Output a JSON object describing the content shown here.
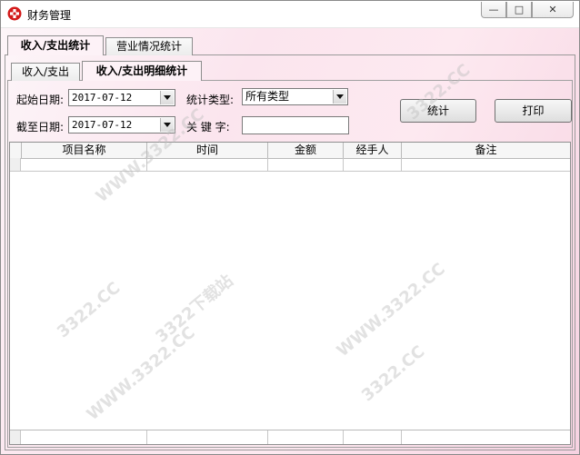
{
  "window": {
    "title": "财务管理",
    "minimize_symbol": "—",
    "maximize_symbol": "□",
    "close_symbol": "✕"
  },
  "tabs_top": [
    {
      "label": "收入/支出统计"
    },
    {
      "label": "营业情况统计"
    }
  ],
  "tabs_sub": [
    {
      "label": "收入/支出"
    },
    {
      "label": "收入/支出明细统计"
    }
  ],
  "filters": {
    "start_date_label": "起始日期:",
    "start_date_value": "2017-07-12",
    "end_date_label": "截至日期:",
    "end_date_value": "2017-07-12",
    "type_label": "统计类型:",
    "type_value": "所有类型",
    "keyword_label": "关 键 字:",
    "keyword_value": ""
  },
  "buttons": {
    "stat": "统计",
    "print": "打印"
  },
  "table": {
    "columns": [
      "项目名称",
      "时间",
      "金额",
      "经手人",
      "备注"
    ]
  },
  "watermark": {
    "lines": [
      "3322.CC",
      "WWW.3322.CC",
      "3322下载站"
    ]
  }
}
